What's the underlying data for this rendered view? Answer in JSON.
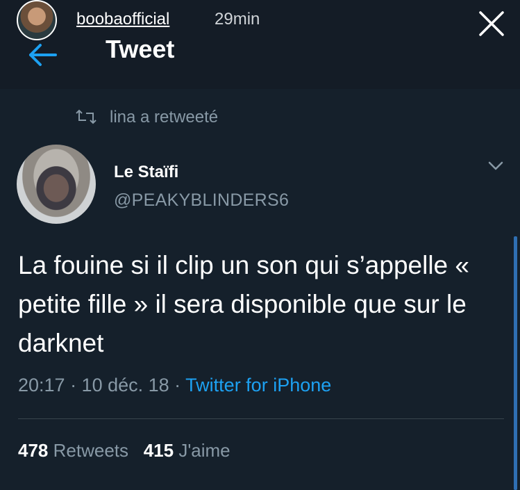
{
  "story": {
    "username": "boobaofficial",
    "time": "29min",
    "avatar_icon": "profile-photo"
  },
  "header": {
    "title": "Tweet",
    "back_icon": "arrow-left-icon"
  },
  "retweet": {
    "text": "lina a retweeté",
    "icon": "retweet-icon"
  },
  "tweet": {
    "author_name": "Le Staïfi",
    "author_handle": "@PEAKYBLINDERS6",
    "body": "La fouine si il clip un son qui s’appelle « petite fille » il sera disponible que sur le darknet",
    "time": "20:17 · 10 déc. 18 · ",
    "source": "Twitter for iPhone",
    "retweets_count": "478",
    "retweets_label": "Retweets",
    "likes_count": "415",
    "likes_label": "J'aime"
  },
  "colors": {
    "background": "#15202b",
    "accent": "#1da1f2",
    "muted": "#8899a6"
  }
}
